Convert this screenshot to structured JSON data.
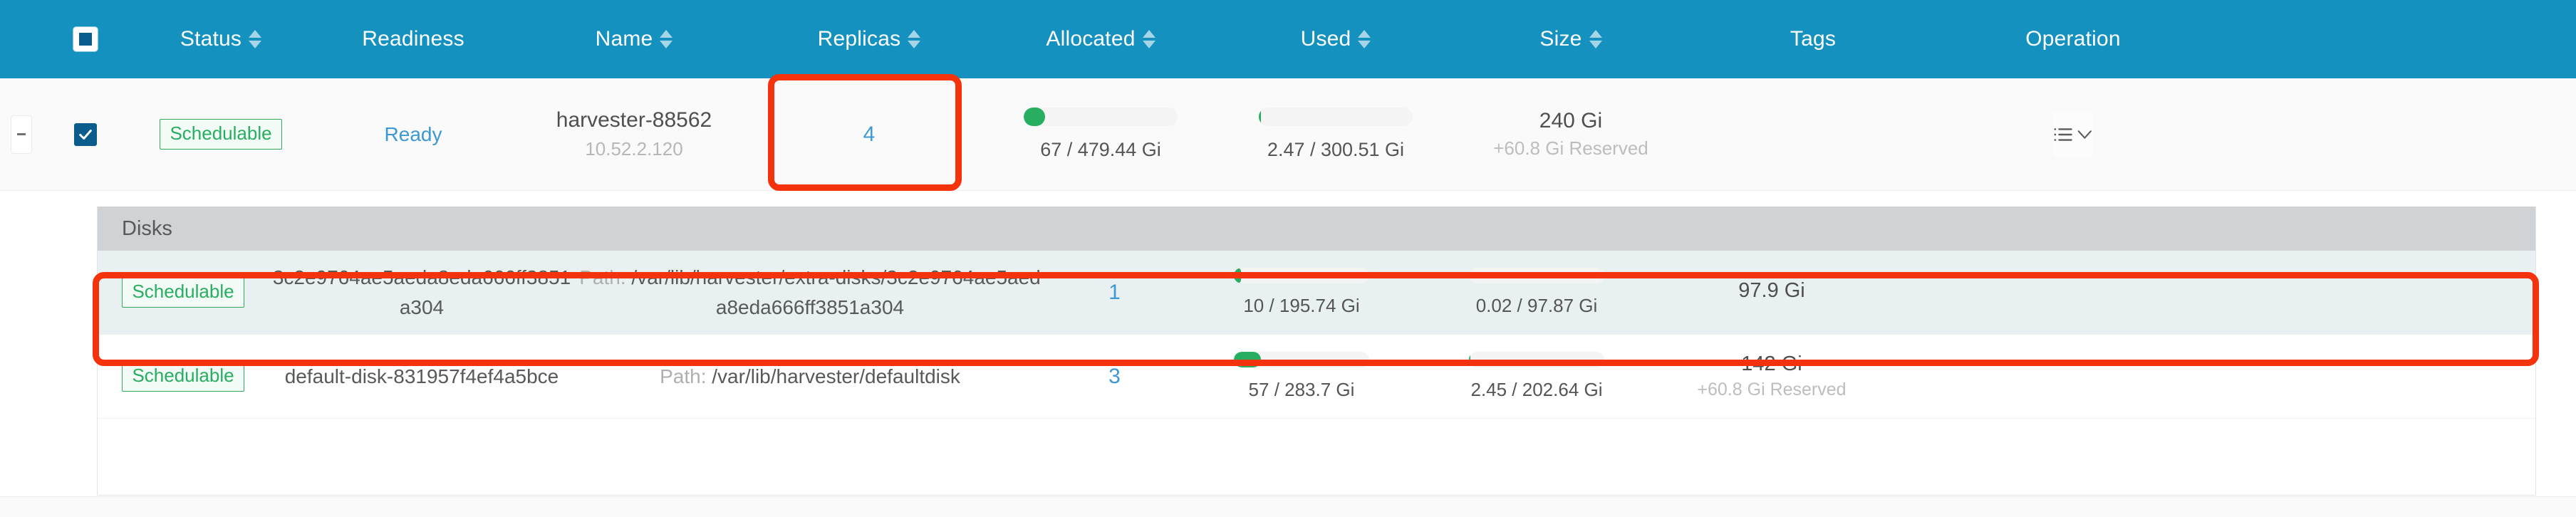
{
  "table": {
    "columns": [
      {
        "key": "expander",
        "label": "",
        "sortable": false
      },
      {
        "key": "select",
        "label": "",
        "sortable": false,
        "icon": "checkbox-indeterminate-icon"
      },
      {
        "key": "status",
        "label": "Status",
        "sortable": true
      },
      {
        "key": "readiness",
        "label": "Readiness",
        "sortable": false
      },
      {
        "key": "name",
        "label": "Name",
        "sortable": true
      },
      {
        "key": "replicas",
        "label": "Replicas",
        "sortable": true
      },
      {
        "key": "allocated",
        "label": "Allocated",
        "sortable": true
      },
      {
        "key": "used",
        "label": "Used",
        "sortable": true
      },
      {
        "key": "size",
        "label": "Size",
        "sortable": true
      },
      {
        "key": "tags",
        "label": "Tags",
        "sortable": false
      },
      {
        "key": "operation",
        "label": "Operation",
        "sortable": false
      }
    ],
    "header_checkbox_state": "indeterminate",
    "accent_color": "#1491BE",
    "selected_row_checkbox_color": "#0A5C8C",
    "progress_color": "#27AE60",
    "badge_color": "#27AE60",
    "link_color": "#3D98D3",
    "annotation_color": "#F4330C"
  },
  "node_row": {
    "expander_icon": "collapse-minus-icon",
    "selected": true,
    "status_badge": "Schedulable",
    "readiness": "Ready",
    "name": "harvester-88562",
    "ip_address": "10.52.2.120",
    "replicas": "4",
    "allocated": {
      "label": "67 / 479.44 Gi",
      "used_value": 67,
      "total_value": 479.44,
      "percent": 14
    },
    "used": {
      "label": "2.47 / 300.51 Gi",
      "used_value": 2.47,
      "total_value": 300.51,
      "percent": 1
    },
    "size": {
      "total": "240 Gi",
      "reserved": "+60.8 Gi Reserved"
    },
    "tags": "",
    "operation_icon": "list-actions-menu-icon"
  },
  "disks_panel": {
    "title": "Disks",
    "rows": [
      {
        "highlighted": true,
        "status_badge": "Schedulable",
        "name": "3c2e9764ae5aeda8eda666ff3851a304",
        "path_label": "Path:",
        "path_value": "/var/lib/harvester/extra-disks/3c2e9764ae5aeda8eda666ff3851a304",
        "replicas": "1",
        "allocated": {
          "label": "10 / 195.74 Gi",
          "used_value": 10,
          "total_value": 195.74,
          "percent": 5
        },
        "used": {
          "label": "0.02 / 97.87 Gi",
          "used_value": 0.02,
          "total_value": 97.87,
          "percent": 0
        },
        "size": {
          "total": "97.9 Gi",
          "reserved": ""
        }
      },
      {
        "highlighted": false,
        "status_badge": "Schedulable",
        "name": "default-disk-831957f4ef4a5bce",
        "path_label": "Path:",
        "path_value": "/var/lib/harvester/defaultdisk",
        "replicas": "3",
        "allocated": {
          "label": "57 / 283.7 Gi",
          "used_value": 57,
          "total_value": 283.7,
          "percent": 20
        },
        "used": {
          "label": "2.45 / 202.64 Gi",
          "used_value": 2.45,
          "total_value": 202.64,
          "percent": 1
        },
        "size": {
          "total": "142 Gi",
          "reserved": "+60.8 Gi Reserved"
        }
      }
    ]
  },
  "annotations": [
    {
      "name": "name-cell-highlight",
      "target": "harvester-88562"
    },
    {
      "name": "first-disk-row-highlight",
      "target": "3c2e9764ae5aeda8eda666ff3851a304"
    }
  ]
}
